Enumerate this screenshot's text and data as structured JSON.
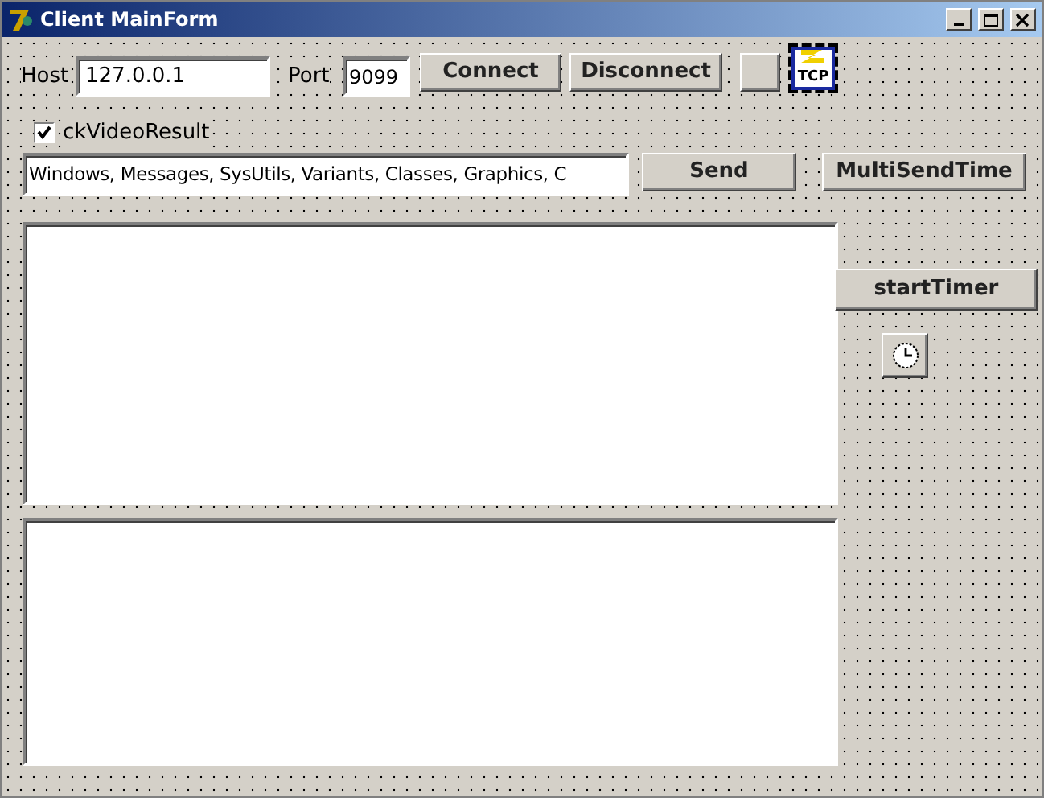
{
  "window": {
    "title": "Client MainForm"
  },
  "host": {
    "label": "Host",
    "value": "127.0.0.1"
  },
  "port": {
    "label": "Port",
    "value": "9099"
  },
  "buttons": [
    {
      "label": "Connect"
    },
    {
      "label": "Disconnect"
    }
  ],
  "tcp_component": {
    "label": "TCP",
    "selected": true
  },
  "checkbox": {
    "label": "ckVideoResult",
    "checked": true
  },
  "message": {
    "value": "Windows, Messages, SysUtils, Variants, Classes, Graphics, C"
  },
  "send_buttons": [
    {
      "label": "Send"
    },
    {
      "label": "MultiSendTime"
    }
  ],
  "timer_button": {
    "label": "startTimer"
  }
}
